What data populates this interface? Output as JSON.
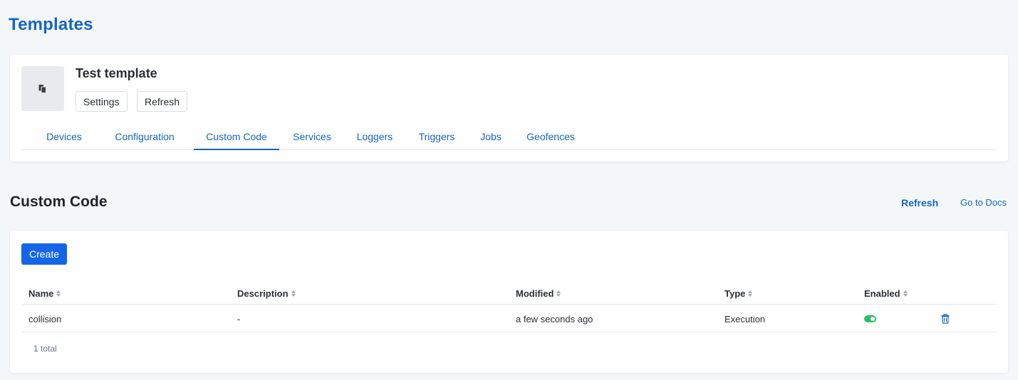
{
  "page": {
    "title": "Templates"
  },
  "template": {
    "name": "Test template",
    "icon": "template-files-icon",
    "buttons": {
      "settings": "Settings",
      "refresh": "Refresh"
    }
  },
  "tabs": [
    {
      "label": "Devices",
      "active": false
    },
    {
      "label": "Configuration",
      "active": false
    },
    {
      "label": "Custom Code",
      "active": true
    },
    {
      "label": "Services",
      "active": false
    },
    {
      "label": "Loggers",
      "active": false
    },
    {
      "label": "Triggers",
      "active": false
    },
    {
      "label": "Jobs",
      "active": false
    },
    {
      "label": "Geofences",
      "active": false
    }
  ],
  "section": {
    "title": "Custom Code",
    "refresh_link": "Refresh",
    "docs_link": "Go to Docs",
    "create_button": "Create"
  },
  "table": {
    "columns": [
      "Name",
      "Description",
      "Modified",
      "Type",
      "Enabled"
    ],
    "rows": [
      {
        "name": "collision",
        "description": "-",
        "modified": "a few seconds ago",
        "type": "Execution",
        "enabled": true
      }
    ],
    "total": "1 total"
  },
  "colors": {
    "accent": "#1565c0",
    "primary_button": "#1565e8",
    "toggle_on": "#2ebd6b",
    "background": "#f4f7f8"
  }
}
